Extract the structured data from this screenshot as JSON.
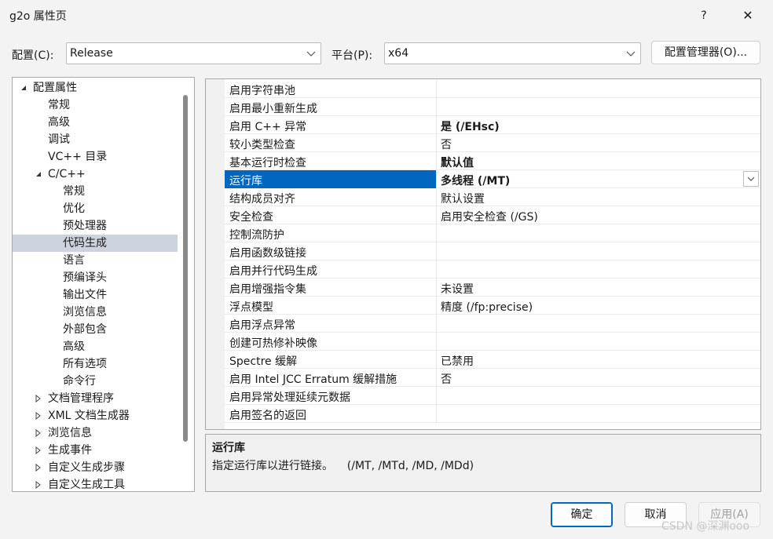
{
  "window": {
    "title": "g2o 属性页",
    "help_label": "?",
    "close_label": "✕"
  },
  "config": {
    "config_label": "配置(C):",
    "config_value": "Release",
    "platform_label": "平台(P):",
    "platform_value": "x64",
    "manager_label": "配置管理器(O)..."
  },
  "tree": {
    "items": [
      {
        "label": "配置属性",
        "expander": "expanded"
      },
      {
        "label": "常规",
        "expander": "none"
      },
      {
        "label": "高级",
        "expander": "none"
      },
      {
        "label": "调试",
        "expander": "none"
      },
      {
        "label": "VC++ 目录",
        "expander": "none"
      },
      {
        "label": "C/C++",
        "expander": "expanded"
      },
      {
        "label": "常规",
        "expander": "none"
      },
      {
        "label": "优化",
        "expander": "none"
      },
      {
        "label": "预处理器",
        "expander": "none"
      },
      {
        "label": "代码生成",
        "expander": "none"
      },
      {
        "label": "语言",
        "expander": "none"
      },
      {
        "label": "预编译头",
        "expander": "none"
      },
      {
        "label": "输出文件",
        "expander": "none"
      },
      {
        "label": "浏览信息",
        "expander": "none"
      },
      {
        "label": "外部包含",
        "expander": "none"
      },
      {
        "label": "高级",
        "expander": "none"
      },
      {
        "label": "所有选项",
        "expander": "none"
      },
      {
        "label": "命令行",
        "expander": "none"
      },
      {
        "label": "文档管理程序",
        "expander": "collapsed"
      },
      {
        "label": "XML 文档生成器",
        "expander": "collapsed"
      },
      {
        "label": "浏览信息",
        "expander": "collapsed"
      },
      {
        "label": "生成事件",
        "expander": "collapsed"
      },
      {
        "label": "自定义生成步骤",
        "expander": "collapsed"
      },
      {
        "label": "自定义生成工具",
        "expander": "collapsed"
      }
    ]
  },
  "grid": {
    "rows": [
      {
        "name": "启用字符串池",
        "value": ""
      },
      {
        "name": "启用最小重新生成",
        "value": ""
      },
      {
        "name": "启用 C++ 异常",
        "value": "是 (/EHsc)"
      },
      {
        "name": "较小类型检查",
        "value": "否"
      },
      {
        "name": "基本运行时检查",
        "value": "默认值"
      },
      {
        "name": "运行库",
        "value": "多线程 (/MT)"
      },
      {
        "name": "结构成员对齐",
        "value": "默认设置"
      },
      {
        "name": "安全检查",
        "value": "启用安全检查 (/GS)"
      },
      {
        "name": "控制流防护",
        "value": ""
      },
      {
        "name": "启用函数级链接",
        "value": ""
      },
      {
        "name": "启用并行代码生成",
        "value": ""
      },
      {
        "name": "启用增强指令集",
        "value": "未设置"
      },
      {
        "name": "浮点模型",
        "value": "精度 (/fp:precise)"
      },
      {
        "name": "启用浮点异常",
        "value": ""
      },
      {
        "name": "创建可热修补映像",
        "value": ""
      },
      {
        "name": "Spectre 缓解",
        "value": "已禁用"
      },
      {
        "name": "启用 Intel JCC Erratum 缓解措施",
        "value": "否"
      },
      {
        "name": "启用异常处理延续元数据",
        "value": ""
      },
      {
        "name": "启用签名的返回",
        "value": ""
      }
    ]
  },
  "description": {
    "title": "运行库",
    "text": "指定运行库以进行链接。    (/MT, /MTd, /MD, /MDd)"
  },
  "buttons": {
    "ok": "确定",
    "cancel": "取消",
    "apply": "应用(A)"
  },
  "watermark": "CSDN @深渊ooo",
  "colors": {
    "selection": "#0067c0",
    "tree_selection": "#cdd3de"
  }
}
